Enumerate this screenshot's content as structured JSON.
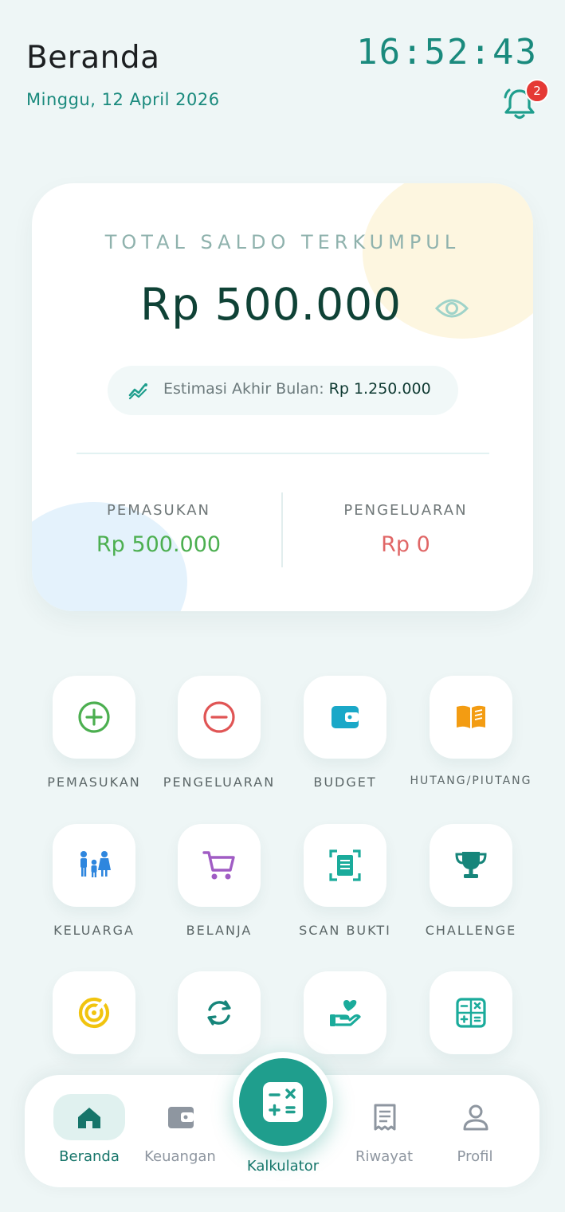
{
  "header": {
    "title": "Beranda",
    "date": "Minggu, 12 April 2026",
    "time": "16:52:43",
    "notification_count": "2"
  },
  "balance_card": {
    "label": "TOTAL SALDO TERKUMPUL",
    "amount": "Rp 500.000",
    "estimate_label": "Estimasi Akhir Bulan:",
    "estimate_value": "Rp 1.250.000",
    "income_label": "PEMASUKAN",
    "income_value": "Rp 500.000",
    "expense_label": "PENGELUARAN",
    "expense_value": "Rp 0"
  },
  "menu": {
    "items": [
      {
        "label": "PEMASUKAN",
        "icon": "plus-circle-icon",
        "color": "#4caf50"
      },
      {
        "label": "PENGELUARAN",
        "icon": "minus-circle-icon",
        "color": "#e05555"
      },
      {
        "label": "BUDGET",
        "icon": "wallet-icon",
        "color": "#1aa8c8"
      },
      {
        "label": "HUTANG/PIUTANG",
        "icon": "book-open-icon",
        "color": "#f39c12"
      },
      {
        "label": "KELUARGA",
        "icon": "family-icon",
        "color": "#2e86de"
      },
      {
        "label": "BELANJA",
        "icon": "shopping-cart-icon",
        "color": "#a05cc4"
      },
      {
        "label": "SCAN BUKTI",
        "icon": "scan-receipt-icon",
        "color": "#1aab9b"
      },
      {
        "label": "CHALLENGE",
        "icon": "trophy-icon",
        "color": "#16857a"
      },
      {
        "label": "",
        "icon": "radar-icon",
        "color": "#f1c40f"
      },
      {
        "label": "",
        "icon": "refresh-icon",
        "color": "#16857a"
      },
      {
        "label": "",
        "icon": "heart-hand-icon",
        "color": "#1aab9b"
      },
      {
        "label": "",
        "icon": "calculator-icon",
        "color": "#1aab9b"
      }
    ]
  },
  "bottom_nav": {
    "items": [
      {
        "label": "Beranda",
        "icon": "home-icon",
        "active": true
      },
      {
        "label": "Keuangan",
        "icon": "wallet-icon",
        "active": false
      },
      {
        "label": "Kalkulator",
        "icon": "calculator-icon",
        "active": false
      },
      {
        "label": "Riwayat",
        "icon": "receipt-icon",
        "active": false
      },
      {
        "label": "Profil",
        "icon": "user-icon",
        "active": false
      }
    ]
  },
  "colors": {
    "primary": "#1f9e8d",
    "background": "#eef6f6",
    "income": "#4caf50",
    "expense": "#e06666",
    "badge": "#e53935"
  }
}
